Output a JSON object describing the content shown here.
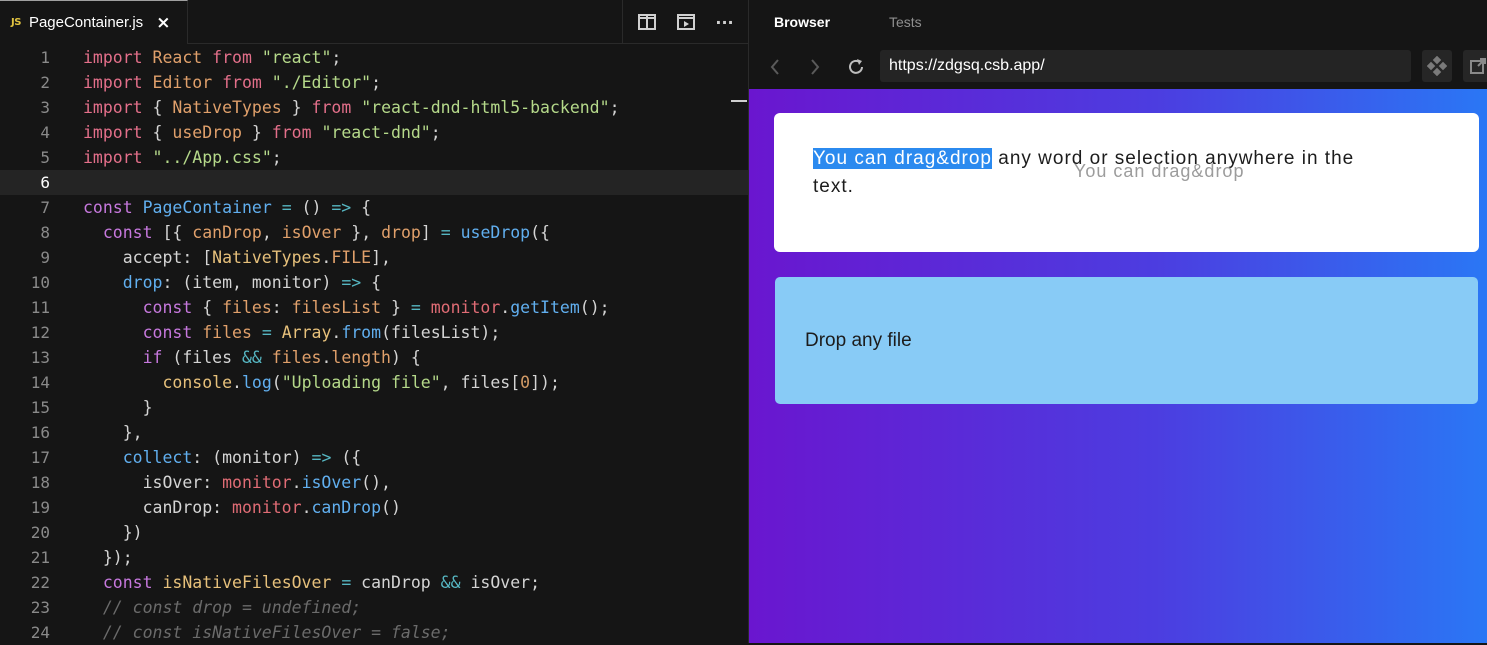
{
  "editor": {
    "tab": {
      "icon_label": "JS",
      "title": "PageContainer.js",
      "close_glyph": "×"
    },
    "actions": [
      "split-editor-icon",
      "open-preview-icon",
      "more-icon"
    ],
    "more_glyph": "···",
    "active_line": 6,
    "lines": [
      {
        "n": "1"
      },
      {
        "n": "2"
      },
      {
        "n": "3"
      },
      {
        "n": "4"
      },
      {
        "n": "5"
      },
      {
        "n": "6"
      },
      {
        "n": "7"
      },
      {
        "n": "8"
      },
      {
        "n": "9"
      },
      {
        "n": "10"
      },
      {
        "n": "11"
      },
      {
        "n": "12"
      },
      {
        "n": "13"
      },
      {
        "n": "14"
      },
      {
        "n": "15"
      },
      {
        "n": "16"
      },
      {
        "n": "17"
      },
      {
        "n": "18"
      },
      {
        "n": "19"
      },
      {
        "n": "20"
      },
      {
        "n": "21"
      },
      {
        "n": "22"
      },
      {
        "n": "23"
      },
      {
        "n": "24"
      }
    ],
    "code": [
      [
        [
          "kw2",
          "import"
        ],
        [
          "plain",
          " "
        ],
        [
          "id",
          "React"
        ],
        [
          "plain",
          " "
        ],
        [
          "kw2",
          "from"
        ],
        [
          "plain",
          " "
        ],
        [
          "str",
          "\"react\""
        ],
        [
          "plain",
          ";"
        ]
      ],
      [
        [
          "kw2",
          "import"
        ],
        [
          "plain",
          " "
        ],
        [
          "id",
          "Editor"
        ],
        [
          "plain",
          " "
        ],
        [
          "kw2",
          "from"
        ],
        [
          "plain",
          " "
        ],
        [
          "str",
          "\"./Editor\""
        ],
        [
          "plain",
          ";"
        ]
      ],
      [
        [
          "kw2",
          "import"
        ],
        [
          "plain",
          " { "
        ],
        [
          "id",
          "NativeTypes"
        ],
        [
          "plain",
          " } "
        ],
        [
          "kw2",
          "from"
        ],
        [
          "plain",
          " "
        ],
        [
          "str",
          "\"react-dnd-html5-backend\""
        ],
        [
          "plain",
          ";"
        ]
      ],
      [
        [
          "kw2",
          "import"
        ],
        [
          "plain",
          " { "
        ],
        [
          "id",
          "useDrop"
        ],
        [
          "plain",
          " } "
        ],
        [
          "kw2",
          "from"
        ],
        [
          "plain",
          " "
        ],
        [
          "str",
          "\"react-dnd\""
        ],
        [
          "plain",
          ";"
        ]
      ],
      [
        [
          "kw2",
          "import"
        ],
        [
          "plain",
          " "
        ],
        [
          "str",
          "\"../App.css\""
        ],
        [
          "plain",
          ";"
        ]
      ],
      [],
      [
        [
          "kw",
          "const"
        ],
        [
          "plain",
          " "
        ],
        [
          "fn",
          "PageContainer"
        ],
        [
          "plain",
          " "
        ],
        [
          "op",
          "="
        ],
        [
          "plain",
          " () "
        ],
        [
          "op",
          "=>"
        ],
        [
          "plain",
          " {"
        ]
      ],
      [
        [
          "plain",
          "  "
        ],
        [
          "kw",
          "const"
        ],
        [
          "plain",
          " [{ "
        ],
        [
          "id",
          "canDrop"
        ],
        [
          "plain",
          ", "
        ],
        [
          "id",
          "isOver"
        ],
        [
          "plain",
          " }, "
        ],
        [
          "id",
          "drop"
        ],
        [
          "plain",
          "] "
        ],
        [
          "op",
          "="
        ],
        [
          "plain",
          " "
        ],
        [
          "fn",
          "useDrop"
        ],
        [
          "plain",
          "({"
        ]
      ],
      [
        [
          "plain",
          "    accept: ["
        ],
        [
          "cls",
          "NativeTypes"
        ],
        [
          "plain",
          "."
        ],
        [
          "id",
          "FILE"
        ],
        [
          "plain",
          "],"
        ]
      ],
      [
        [
          "plain",
          "    "
        ],
        [
          "fn",
          "drop"
        ],
        [
          "plain",
          ": (item, monitor) "
        ],
        [
          "op",
          "=>"
        ],
        [
          "plain",
          " {"
        ]
      ],
      [
        [
          "plain",
          "      "
        ],
        [
          "kw",
          "const"
        ],
        [
          "plain",
          " { "
        ],
        [
          "id",
          "files"
        ],
        [
          "plain",
          ": "
        ],
        [
          "id",
          "filesList"
        ],
        [
          "plain",
          " } "
        ],
        [
          "op",
          "="
        ],
        [
          "plain",
          " "
        ],
        [
          "prop",
          "monitor"
        ],
        [
          "plain",
          "."
        ],
        [
          "fn",
          "getItem"
        ],
        [
          "plain",
          "();"
        ]
      ],
      [
        [
          "plain",
          "      "
        ],
        [
          "kw",
          "const"
        ],
        [
          "plain",
          " "
        ],
        [
          "id",
          "files"
        ],
        [
          "plain",
          " "
        ],
        [
          "op",
          "="
        ],
        [
          "plain",
          " "
        ],
        [
          "cls",
          "Array"
        ],
        [
          "plain",
          "."
        ],
        [
          "fn",
          "from"
        ],
        [
          "plain",
          "(filesList);"
        ]
      ],
      [
        [
          "plain",
          "      "
        ],
        [
          "kw",
          "if"
        ],
        [
          "plain",
          " (files "
        ],
        [
          "op",
          "&&"
        ],
        [
          "plain",
          " "
        ],
        [
          "id",
          "files"
        ],
        [
          "plain",
          "."
        ],
        [
          "id",
          "length"
        ],
        [
          "plain",
          ") {"
        ]
      ],
      [
        [
          "plain",
          "        "
        ],
        [
          "cls",
          "console"
        ],
        [
          "plain",
          "."
        ],
        [
          "fn",
          "log"
        ],
        [
          "plain",
          "("
        ],
        [
          "str",
          "\"Uploading file\""
        ],
        [
          "plain",
          ", files["
        ],
        [
          "num",
          "0"
        ],
        [
          "plain",
          "]);"
        ]
      ],
      [
        [
          "plain",
          "      }"
        ]
      ],
      [
        [
          "plain",
          "    },"
        ]
      ],
      [
        [
          "plain",
          "    "
        ],
        [
          "fn",
          "collect"
        ],
        [
          "plain",
          ": (monitor) "
        ],
        [
          "op",
          "=>"
        ],
        [
          "plain",
          " ({"
        ]
      ],
      [
        [
          "plain",
          "      isOver: "
        ],
        [
          "prop",
          "monitor"
        ],
        [
          "plain",
          "."
        ],
        [
          "fn",
          "isOver"
        ],
        [
          "plain",
          "(),"
        ]
      ],
      [
        [
          "plain",
          "      canDrop: "
        ],
        [
          "prop",
          "monitor"
        ],
        [
          "plain",
          "."
        ],
        [
          "fn",
          "canDrop"
        ],
        [
          "plain",
          "()"
        ]
      ],
      [
        [
          "plain",
          "    })"
        ]
      ],
      [
        [
          "plain",
          "  });"
        ]
      ],
      [
        [
          "plain",
          "  "
        ],
        [
          "kw",
          "const"
        ],
        [
          "plain",
          " "
        ],
        [
          "cls",
          "isNativeFilesOver"
        ],
        [
          "plain",
          " "
        ],
        [
          "op",
          "="
        ],
        [
          "plain",
          " canDrop "
        ],
        [
          "op",
          "&&"
        ],
        [
          "plain",
          " isOver;"
        ]
      ],
      [
        [
          "cmt",
          "  // const drop = undefined;"
        ]
      ],
      [
        [
          "cmt",
          "  // const isNativeFilesOver = false;"
        ]
      ]
    ]
  },
  "browser": {
    "tabs": {
      "active": "Browser",
      "inactive": "Tests"
    },
    "url": "https://zdgsq.csb.app/",
    "page": {
      "selected_text": "You can drag&drop",
      "rest_line1": " any word or selection anywhere in the",
      "rest_line2": "text.",
      "drag_ghost": "You can drag&drop",
      "drop_zone_label": "Drop any file"
    },
    "colors": {
      "gradient_start": "#6a16cf",
      "gradient_end": "#2a77f5",
      "selection": "#2b8aef",
      "drop_zone": "#88cbf6"
    }
  }
}
